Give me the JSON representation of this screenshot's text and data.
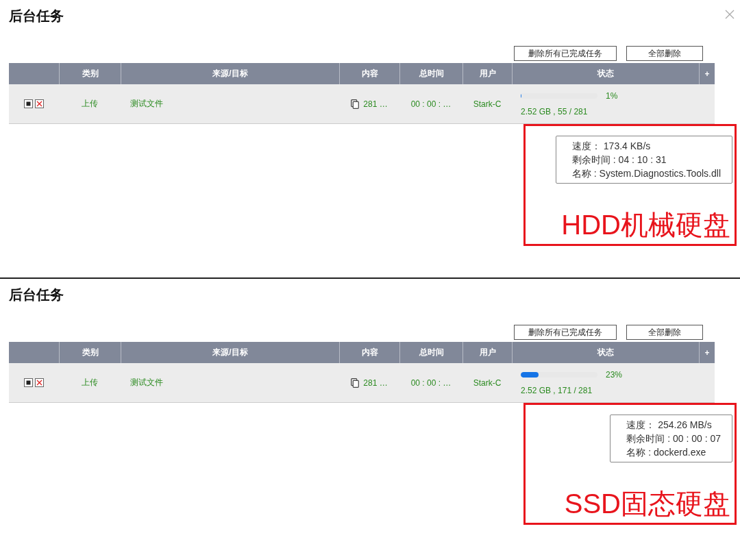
{
  "panels": [
    {
      "title": "后台任务",
      "closable": true,
      "buttons": [
        "删除所有已完成任务",
        "全部删除"
      ],
      "columns": [
        "类别",
        "来源/目标",
        "内容",
        "总时间",
        "用户",
        "状态",
        "+"
      ],
      "task": {
        "category": "上传",
        "source": "测试文件",
        "content": "281 …",
        "total_time": "00 : 00 : …",
        "user": "Stark-C",
        "level": 0.01,
        "percent": "1%",
        "detail": "2.52 GB , 55 / 281"
      },
      "tooltip": [
        "速度： 173.4 KB/s",
        "剩余时间 : 04 : 10 : 31",
        "名称 : System.Diagnostics.Tools.dll"
      ],
      "annotation": "HDD机械硬盘"
    },
    {
      "title": "后台任务",
      "closable": false,
      "buttons": [
        "删除所有已完成任务",
        "全部删除"
      ],
      "columns": [
        "类别",
        "来源/目标",
        "内容",
        "总时间",
        "用户",
        "状态",
        "+"
      ],
      "task": {
        "category": "上传",
        "source": "测试文件",
        "content": "281 …",
        "total_time": "00 : 00 : …",
        "user": "Stark-C",
        "level": 0.23,
        "percent": "23%",
        "detail": "2.52 GB , 171 / 281"
      },
      "tooltip": [
        "速度： 254.26 MB/s",
        "剩余时间 : 00 : 00 : 07",
        "名称 : dockerd.exe"
      ],
      "annotation": "SSD固态硬盘"
    }
  ]
}
